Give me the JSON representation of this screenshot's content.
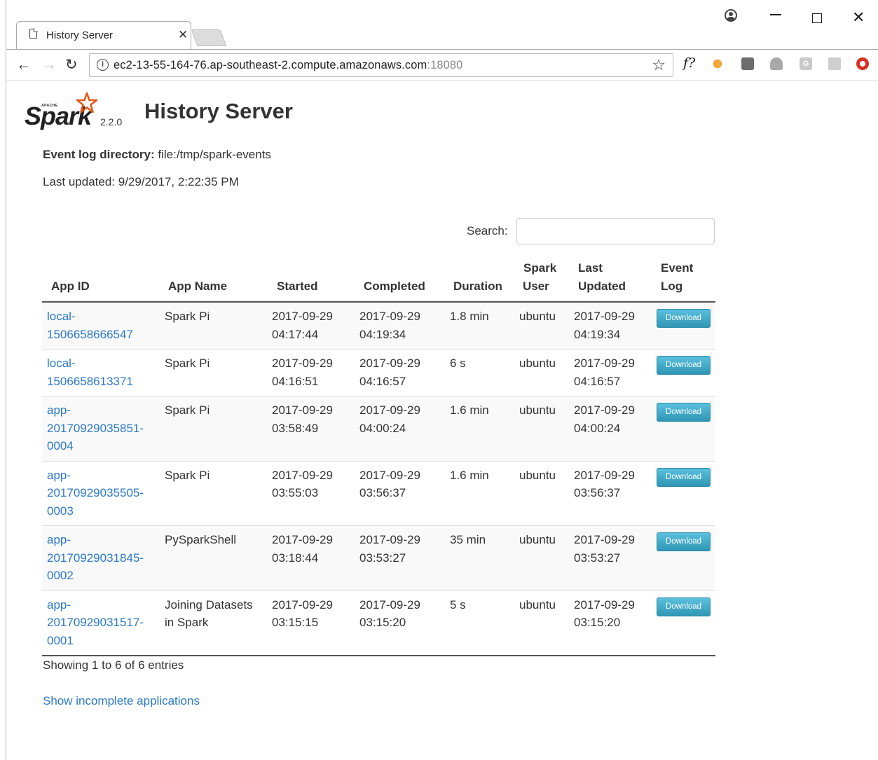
{
  "browser": {
    "tab_title": "History Server",
    "tab_close": "✕",
    "url": "ec2-13-55-164-76.ap-southeast-2.compute.amazonaws.com",
    "url_port": ":18080",
    "ext_fq": "f?",
    "ext_g": "G"
  },
  "header": {
    "logo_apache": "APACHE",
    "logo_text": "Spark",
    "version": "2.2.0",
    "title": "History Server"
  },
  "meta": {
    "event_log_label": "Event log directory:",
    "event_log_value": "file:/tmp/spark-events",
    "last_updated": "Last updated: 9/29/2017, 2:22:35 PM"
  },
  "search": {
    "label": "Search:",
    "value": ""
  },
  "table": {
    "headers": {
      "app_id": "App ID",
      "app_name": "App Name",
      "started": "Started",
      "completed": "Completed",
      "duration": "Duration",
      "spark_user_1": "Spark",
      "spark_user_2": "User",
      "last_updated_1": "Last",
      "last_updated_2": "Updated",
      "event_log_1": "Event",
      "event_log_2": "Log"
    },
    "download_label": "Download",
    "rows": [
      {
        "app_id_1": "local-",
        "app_id_2": "1506658666547",
        "app_id_3": "",
        "name_1": "Spark Pi",
        "name_2": "",
        "started_1": "2017-09-29",
        "started_2": "04:17:44",
        "completed_1": "2017-09-29",
        "completed_2": "04:19:34",
        "duration": "1.8 min",
        "user": "ubuntu",
        "updated_1": "2017-09-29",
        "updated_2": "04:19:34"
      },
      {
        "app_id_1": "local-",
        "app_id_2": "1506658613371",
        "app_id_3": "",
        "name_1": "Spark Pi",
        "name_2": "",
        "started_1": "2017-09-29",
        "started_2": "04:16:51",
        "completed_1": "2017-09-29",
        "completed_2": "04:16:57",
        "duration": "6 s",
        "user": "ubuntu",
        "updated_1": "2017-09-29",
        "updated_2": "04:16:57"
      },
      {
        "app_id_1": "app-",
        "app_id_2": "20170929035851-",
        "app_id_3": "0004",
        "name_1": "Spark Pi",
        "name_2": "",
        "started_1": "2017-09-29",
        "started_2": "03:58:49",
        "completed_1": "2017-09-29",
        "completed_2": "04:00:24",
        "duration": "1.6 min",
        "user": "ubuntu",
        "updated_1": "2017-09-29",
        "updated_2": "04:00:24"
      },
      {
        "app_id_1": "app-",
        "app_id_2": "20170929035505-",
        "app_id_3": "0003",
        "name_1": "Spark Pi",
        "name_2": "",
        "started_1": "2017-09-29",
        "started_2": "03:55:03",
        "completed_1": "2017-09-29",
        "completed_2": "03:56:37",
        "duration": "1.6 min",
        "user": "ubuntu",
        "updated_1": "2017-09-29",
        "updated_2": "03:56:37"
      },
      {
        "app_id_1": "app-",
        "app_id_2": "20170929031845-",
        "app_id_3": "0002",
        "name_1": "PySparkShell",
        "name_2": "",
        "started_1": "2017-09-29",
        "started_2": "03:18:44",
        "completed_1": "2017-09-29",
        "completed_2": "03:53:27",
        "duration": "35 min",
        "user": "ubuntu",
        "updated_1": "2017-09-29",
        "updated_2": "03:53:27"
      },
      {
        "app_id_1": "app-",
        "app_id_2": "20170929031517-",
        "app_id_3": "0001",
        "name_1": "Joining Datasets",
        "name_2": "in Spark",
        "started_1": "2017-09-29",
        "started_2": "03:15:15",
        "completed_1": "2017-09-29",
        "completed_2": "03:15:20",
        "duration": "5 s",
        "user": "ubuntu",
        "updated_1": "2017-09-29",
        "updated_2": "03:15:20"
      }
    ]
  },
  "footer": {
    "showing": "Showing 1 to 6 of 6 entries",
    "incomplete_link": "Show incomplete applications"
  },
  "colors": {
    "link": "#2a79c9",
    "download_button": "#5bc0de",
    "star": "#e25a1c"
  }
}
